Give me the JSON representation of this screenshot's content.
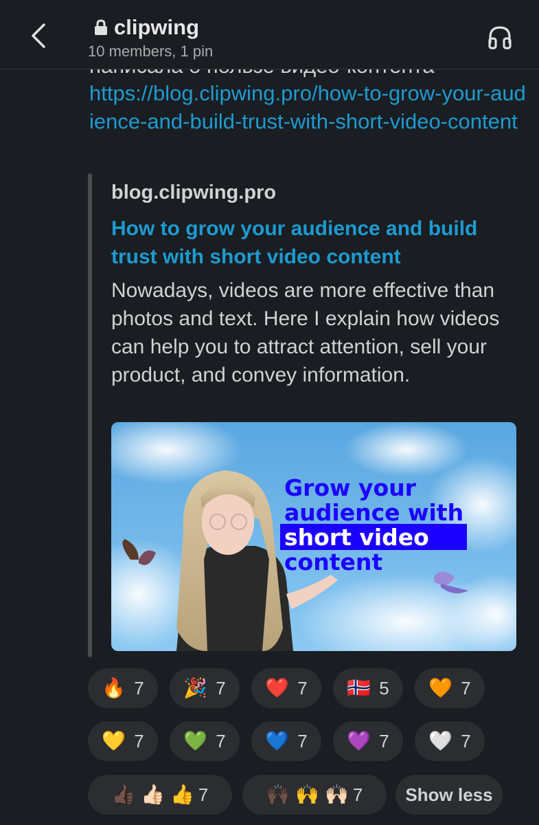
{
  "header": {
    "channel_name": "clipwing",
    "members_text": "10 members, 1 pin"
  },
  "message": {
    "cut_text": "написала о пользе видео-контента",
    "link": "https://blog.clipwing.pro/how-to-grow-your-audience-and-build-trust-with-short-video-content"
  },
  "unfurl": {
    "site": "blog.clipwing.pro",
    "title": "How to grow your audience and build trust with short video content",
    "description": "Nowadays, videos are more effective than photos and text. Here I explain how videos can help you to attract attention, sell your product, and convey information.",
    "image_text": {
      "line1": "Grow your",
      "line2": "audience with",
      "line3": "short video",
      "line4": "content"
    }
  },
  "reactions": [
    {
      "emoji": "🔥",
      "count": "7"
    },
    {
      "emoji": "🎉",
      "count": "7"
    },
    {
      "emoji": "❤️",
      "count": "7"
    },
    {
      "emoji": "🇳🇴",
      "count": "5"
    },
    {
      "emoji": "🧡",
      "count": "7"
    },
    {
      "emoji": "💛",
      "count": "7"
    },
    {
      "emoji": "💚",
      "count": "7"
    },
    {
      "emoji": "💙",
      "count": "7"
    },
    {
      "emoji": "💜",
      "count": "7"
    },
    {
      "emoji": "🤍",
      "count": "7"
    },
    {
      "emoji": "👍🏿 👍🏻 👍",
      "count": "7"
    },
    {
      "emoji": "🙌🏿 🙌 🙌🏻",
      "count": "7"
    }
  ],
  "show_less_label": "Show less",
  "colors": {
    "background": "#1a1d21",
    "link": "#1d9bd1",
    "pill": "#2b2d31",
    "image_text": "#1c00ff"
  }
}
